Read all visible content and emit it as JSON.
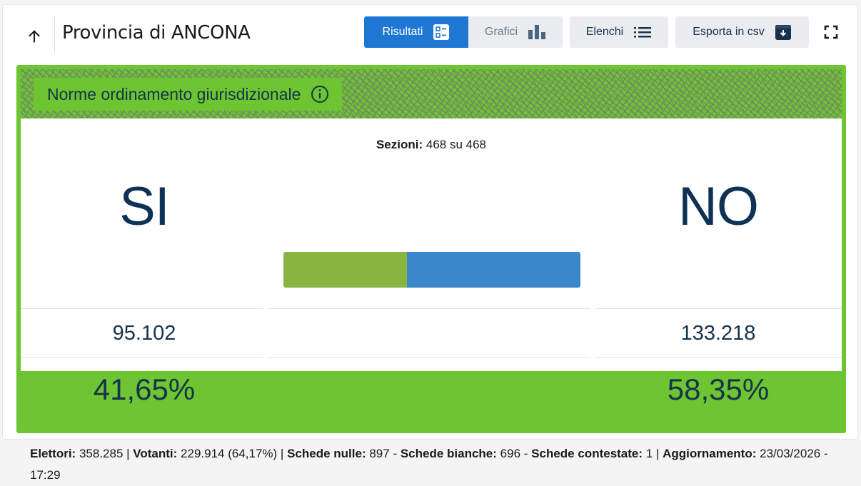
{
  "header": {
    "title": "Provincia di ANCONA",
    "buttons": {
      "results": "Risultati",
      "charts": "Grafici",
      "lists": "Elenchi",
      "export": "Esporta in csv"
    }
  },
  "referendum": {
    "title": "Norme ordinamento giurisdizionale",
    "sections_label": "Sezioni:",
    "sections_value": "468 su 468",
    "yes": {
      "label": "SI",
      "votes": "95.102",
      "percent": "41,65%",
      "share": 0.4165,
      "color": "#88b540"
    },
    "no": {
      "label": "NO",
      "votes": "133.218",
      "percent": "58,35%",
      "share": 0.5835,
      "color": "#3a87cc"
    }
  },
  "footer": {
    "voters_label": "Elettori:",
    "voters_value": "358.285",
    "turnout_label": "Votanti:",
    "turnout_value": "229.914 (64,17%)",
    "null_label": "Schede nulle:",
    "null_value": "897",
    "blank_label": "Schede bianche:",
    "blank_value": "696",
    "contested_label": "Schede contestate:",
    "contested_value": "1",
    "updated_label": "Aggiornamento:",
    "updated_value": "23/03/2026 - 17:29"
  },
  "icons": {
    "back": "arrow-up-icon",
    "results": "list-view-icon",
    "charts": "bar-chart-icon",
    "lists": "list-icon",
    "export": "download-box-icon",
    "fullscreen": "fullscreen-icon",
    "info": "info-icon"
  },
  "colors": {
    "accent_green": "#6cc531",
    "primary_blue": "#1f77d4",
    "text_dark": "#17324d"
  }
}
